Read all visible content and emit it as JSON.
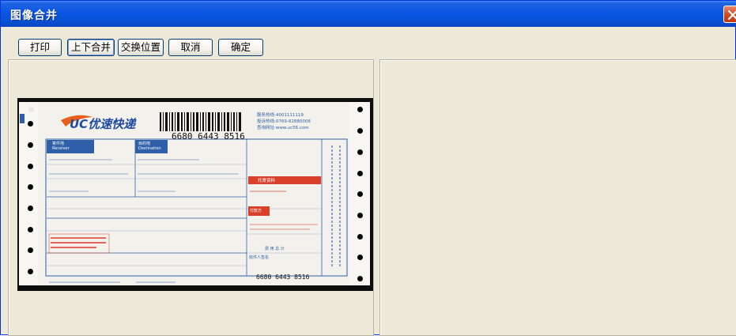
{
  "window": {
    "title": "图像合并"
  },
  "toolbar": {
    "buttons": [
      {
        "label": "打印"
      },
      {
        "label": "上下合并"
      },
      {
        "label": "交换位置"
      },
      {
        "label": "取消"
      },
      {
        "label": "确定"
      }
    ]
  },
  "document": {
    "brand": "UC优速快递",
    "barcode_number": "6680 6443 8516",
    "bottom_number": "6680 6443 8516",
    "hotline": "服务热线:4001111119",
    "complaint": "投诉热线:0769-82880008",
    "website": "查询网址:www.uc56.com",
    "receiver_label_cn": "寄件地",
    "receiver_label_en": "Receiver",
    "destination_label_cn": "目的地",
    "destination_label_en": "Destination",
    "red_box_label": "托寄资料",
    "red_label_2": "付款方",
    "bottom_right_label": "收件人签名",
    "total_label": "费 用 总 计",
    "colors": {
      "blue": "#2e5fa8",
      "red": "#d8402a",
      "brand_orange": "#e8601c"
    }
  }
}
